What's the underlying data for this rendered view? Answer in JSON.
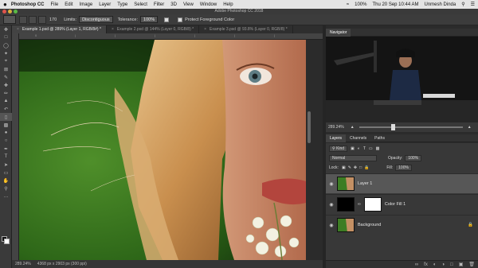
{
  "menubar": {
    "app": "Photoshop CC",
    "items": [
      "File",
      "Edit",
      "Image",
      "Layer",
      "Type",
      "Select",
      "Filter",
      "3D",
      "View",
      "Window",
      "Help"
    ],
    "battery": "100%",
    "datetime": "Thu 20 Sep 10:44 AM",
    "user": "Unmesh Dinda"
  },
  "window_title": "Adobe Photoshop CC 2018",
  "options": {
    "size": "170",
    "limits_label": "Limits:",
    "limits_value": "Discontiguous",
    "tolerance_label": "Tolerance:",
    "tolerance_value": "100%",
    "protect_label": "Protect Foreground Color"
  },
  "tabs": [
    "Example 1.psd @ 289% (Layer 1, RGB/8#) *",
    "Example 2.psd @ 144% (Layer 0, RGB/8) *",
    "Example 3.psd @ 93.8% (Layer 0, RGB/8) *"
  ],
  "status": {
    "zoom": "289.24%",
    "doc": "4368 px x 2903 px (300 ppi)"
  },
  "navigator": {
    "title": "Navigator",
    "zoom": "289.24%"
  },
  "layers": {
    "tabs": [
      "Layers",
      "Channels",
      "Paths"
    ],
    "kind": "Kind",
    "blend": "Normal",
    "opacity_label": "Opacity:",
    "opacity": "100%",
    "lock_label": "Lock:",
    "fill_label": "Fill:",
    "fill": "100%",
    "items": [
      "Layer 1",
      "Color Fill 1",
      "Background"
    ]
  }
}
